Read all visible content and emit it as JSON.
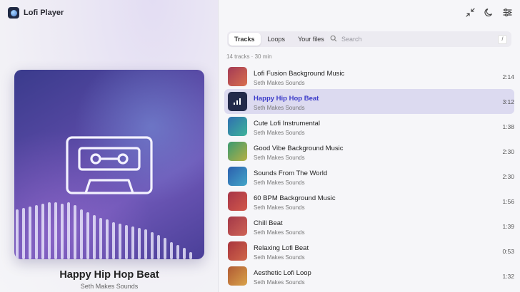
{
  "app": {
    "title": "Lofi Player"
  },
  "now_playing": {
    "title": "Happy Hip Hop Beat",
    "artist": "Seth Makes Sounds"
  },
  "toolbar": {
    "icons": [
      "collapse-icon",
      "moon-icon",
      "sliders-icon"
    ]
  },
  "tabs": [
    {
      "label": "Tracks",
      "active": true
    },
    {
      "label": "Loops",
      "active": false
    },
    {
      "label": "Your files",
      "active": false
    }
  ],
  "search": {
    "placeholder": "Search",
    "shortcut": "/"
  },
  "list_meta": "14 tracks · 30 min",
  "tracks": [
    {
      "title": "Lofi Fusion Background Music",
      "artist": "Seth Makes Sounds",
      "duration": "2:14",
      "colors": [
        "#a33a55",
        "#d9704f"
      ],
      "active": false
    },
    {
      "title": "Happy Hip Hop Beat",
      "artist": "Seth Makes Sounds",
      "duration": "3:12",
      "colors": [
        "#232a4a",
        "#232a4a"
      ],
      "active": true
    },
    {
      "title": "Cute Lofi Instrumental",
      "artist": "Seth Makes Sounds",
      "duration": "1:38",
      "colors": [
        "#2f6fb0",
        "#3fb49a"
      ],
      "active": false
    },
    {
      "title": "Good Vibe Background Music",
      "artist": "Seth Makes Sounds",
      "duration": "2:30",
      "colors": [
        "#3a9a70",
        "#b5b044"
      ],
      "active": false
    },
    {
      "title": "Sounds From The World",
      "artist": "Seth Makes Sounds",
      "duration": "2:30",
      "colors": [
        "#2b5fae",
        "#44a6c8"
      ],
      "active": false
    },
    {
      "title": "60 BPM Background Music",
      "artist": "Seth Makes Sounds",
      "duration": "1:56",
      "colors": [
        "#a63448",
        "#d2584a"
      ],
      "active": false
    },
    {
      "title": "Chill Beat",
      "artist": "Seth Makes Sounds",
      "duration": "1:39",
      "colors": [
        "#a33848",
        "#cf6456"
      ],
      "active": false
    },
    {
      "title": "Relaxing Lofi Beat",
      "artist": "Seth Makes Sounds",
      "duration": "0:53",
      "colors": [
        "#a8343d",
        "#d0674a"
      ],
      "active": false
    },
    {
      "title": "Aesthetic Lofi Loop",
      "artist": "Seth Makes Sounds",
      "duration": "1:32",
      "colors": [
        "#b05a34",
        "#d9a34a"
      ],
      "active": false
    }
  ],
  "cover": {
    "icon": "cassette-icon"
  }
}
